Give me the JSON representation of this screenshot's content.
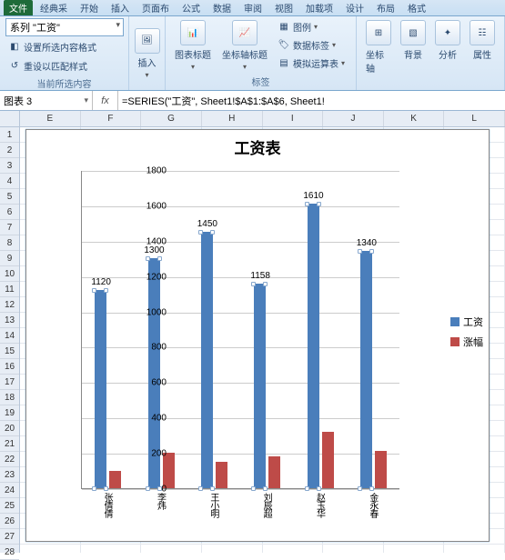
{
  "tabs": {
    "file": "文件",
    "list": [
      "经典采",
      "开始",
      "插入",
      "页面布",
      "公式",
      "数据",
      "审阅",
      "视图",
      "加载项",
      "设计",
      "布局",
      "格式"
    ]
  },
  "ribbon": {
    "series_combo": "系列 \"工资\"",
    "format_sel": "设置所选内容格式",
    "reset_style": "重设以匹配样式",
    "group_sel": "当前所选内容",
    "insert": "插入",
    "chart_title": "图表标题",
    "axis_title": "坐标轴标题",
    "legend": "图例",
    "data_labels": "数据标签",
    "data_table": "模拟运算表",
    "group_labels": "标签",
    "axes": "坐标轴",
    "background": "背景",
    "analysis": "分析",
    "properties": "属性"
  },
  "formula": {
    "name": "图表 3",
    "fx": "fx",
    "value": "=SERIES(\"工资\", Sheet1!$A$1:$A$6, Sheet1!"
  },
  "cols": [
    "E",
    "F",
    "G",
    "H",
    "I",
    "J",
    "K",
    "L"
  ],
  "rows": [
    1,
    2,
    3,
    4,
    5,
    6,
    7,
    8,
    9,
    10,
    11,
    12,
    13,
    14,
    15,
    16,
    17,
    18,
    19,
    20,
    21,
    22,
    23,
    24,
    25,
    26,
    27,
    28
  ],
  "chart_data": {
    "type": "bar",
    "title": "工资表",
    "categories": [
      "张倩倩",
      "李炜",
      "王小明",
      "刘辰超",
      "赵玉华",
      "金永春"
    ],
    "series": [
      {
        "name": "工资",
        "values": [
          1120,
          1300,
          1450,
          1158,
          1610,
          1340
        ],
        "color": "#4a7ebb"
      },
      {
        "name": "涨幅",
        "values": [
          100,
          200,
          150,
          180,
          320,
          210
        ],
        "color": "#be4b48"
      }
    ],
    "ylim": [
      0,
      1800
    ],
    "yticks": [
      0,
      200,
      400,
      600,
      800,
      1000,
      1200,
      1400,
      1600,
      1800
    ]
  }
}
